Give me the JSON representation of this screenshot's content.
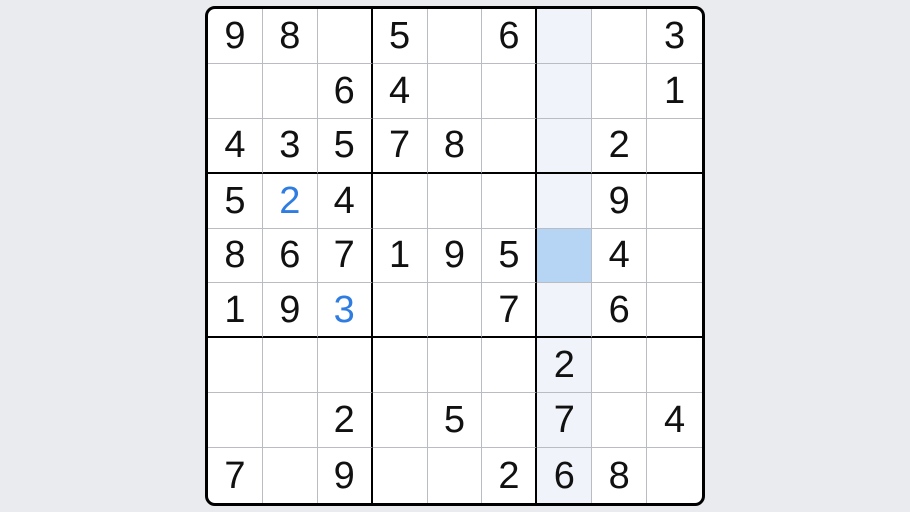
{
  "sudoku": {
    "grid": [
      [
        {
          "v": "9"
        },
        {
          "v": "8"
        },
        {
          "v": ""
        },
        {
          "v": "5"
        },
        {
          "v": ""
        },
        {
          "v": "6"
        },
        {
          "v": ""
        },
        {
          "v": ""
        },
        {
          "v": "3"
        }
      ],
      [
        {
          "v": ""
        },
        {
          "v": ""
        },
        {
          "v": "6"
        },
        {
          "v": "4"
        },
        {
          "v": ""
        },
        {
          "v": ""
        },
        {
          "v": ""
        },
        {
          "v": ""
        },
        {
          "v": "1"
        }
      ],
      [
        {
          "v": "4"
        },
        {
          "v": "3"
        },
        {
          "v": "5"
        },
        {
          "v": "7"
        },
        {
          "v": "8"
        },
        {
          "v": ""
        },
        {
          "v": ""
        },
        {
          "v": "2"
        },
        {
          "v": ""
        }
      ],
      [
        {
          "v": "5"
        },
        {
          "v": "2",
          "u": true
        },
        {
          "v": "4"
        },
        {
          "v": ""
        },
        {
          "v": ""
        },
        {
          "v": ""
        },
        {
          "v": ""
        },
        {
          "v": "9"
        },
        {
          "v": ""
        }
      ],
      [
        {
          "v": "8"
        },
        {
          "v": "6"
        },
        {
          "v": "7"
        },
        {
          "v": "1"
        },
        {
          "v": "9"
        },
        {
          "v": "5"
        },
        {
          "v": ""
        },
        {
          "v": "4"
        },
        {
          "v": ""
        }
      ],
      [
        {
          "v": "1"
        },
        {
          "v": "9"
        },
        {
          "v": "3",
          "u": true
        },
        {
          "v": ""
        },
        {
          "v": ""
        },
        {
          "v": "7"
        },
        {
          "v": ""
        },
        {
          "v": "6"
        },
        {
          "v": ""
        }
      ],
      [
        {
          "v": ""
        },
        {
          "v": ""
        },
        {
          "v": ""
        },
        {
          "v": ""
        },
        {
          "v": ""
        },
        {
          "v": ""
        },
        {
          "v": "2"
        },
        {
          "v": ""
        },
        {
          "v": ""
        }
      ],
      [
        {
          "v": ""
        },
        {
          "v": ""
        },
        {
          "v": "2"
        },
        {
          "v": ""
        },
        {
          "v": "5"
        },
        {
          "v": ""
        },
        {
          "v": "7"
        },
        {
          "v": ""
        },
        {
          "v": "4"
        }
      ],
      [
        {
          "v": "7"
        },
        {
          "v": ""
        },
        {
          "v": "9"
        },
        {
          "v": ""
        },
        {
          "v": ""
        },
        {
          "v": "2"
        },
        {
          "v": "6"
        },
        {
          "v": "8"
        },
        {
          "v": ""
        }
      ]
    ],
    "selected": {
      "row": 4,
      "col": 6
    },
    "highlight_col": 6
  }
}
